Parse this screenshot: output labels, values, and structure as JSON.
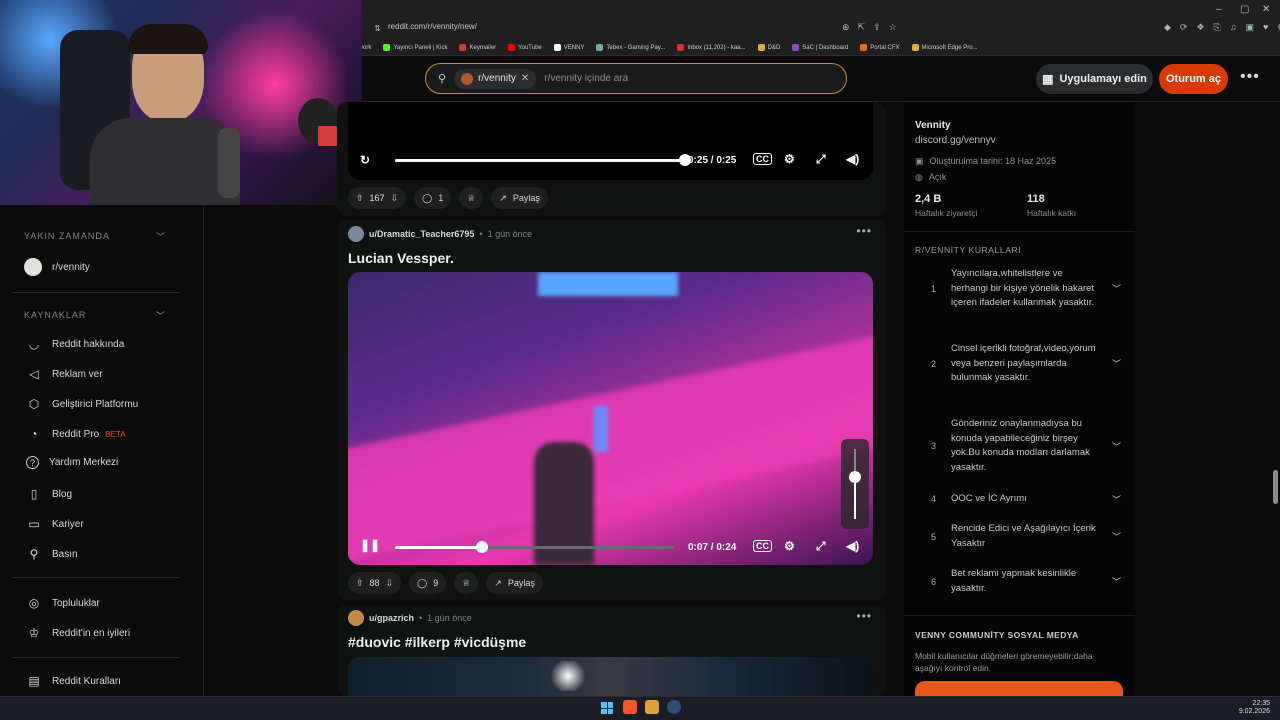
{
  "browser": {
    "url": "reddit.com/r/vennity/new/",
    "bookmarks": [
      "twork",
      "Yayıncı Paneli | Kick",
      "Keymailer",
      "YouTube",
      "VENNY",
      "Tebex - Gaming Pay...",
      "Inbox (11,202) - kaa...",
      "D&D",
      "SaC | Dashboard",
      "Portal CFX",
      "Microsoft Edge Pro..."
    ],
    "window_controls": [
      "–",
      "▢",
      "✕"
    ]
  },
  "header": {
    "community_chip": "r/vennity",
    "search_placeholder": "r/vennity içinde ara",
    "app_button": "Uygulamayı edin",
    "login_button": "Oturum aç",
    "more": "•••"
  },
  "sidebar": {
    "recent_title": "YAKIN ZAMANDA",
    "recent_item": "r/vennity",
    "resources_title": "KAYNAKLAR",
    "resources": [
      {
        "label": "Reddit hakkında",
        "icon": "alien-icon",
        "glyph": "◡"
      },
      {
        "label": "Reklam ver",
        "icon": "megaphone-icon",
        "glyph": "◁"
      },
      {
        "label": "Geliştirici Platformu",
        "icon": "hexagon-icon",
        "glyph": "⬡"
      },
      {
        "label": "Reddit Pro",
        "icon": "pro-icon",
        "glyph": "◔",
        "badge": "BETA"
      },
      {
        "label": "Yardım Merkezi",
        "icon": "help-icon",
        "glyph": "?"
      },
      {
        "label": "Blog",
        "icon": "book-icon",
        "glyph": "▯"
      },
      {
        "label": "Kariyer",
        "icon": "briefcase-icon",
        "glyph": "▭"
      },
      {
        "label": "Basın",
        "icon": "mic-icon",
        "glyph": "⚲"
      }
    ],
    "communities": [
      {
        "label": "Topluluklar",
        "icon": "communities-icon",
        "glyph": "◎"
      },
      {
        "label": "Reddit'in en iyileri",
        "icon": "best-of-icon",
        "glyph": "♔"
      }
    ],
    "rules_link": {
      "label": "Reddit Kuralları",
      "icon": "rules-icon",
      "glyph": "▤"
    }
  },
  "posts": [
    {
      "time_display": "0:25 / 0:25",
      "progress": 1.0,
      "upvotes": "167",
      "comments": "1",
      "share": "Paylaş"
    },
    {
      "user": "u/Dramatic_Teacher6795",
      "time": "1 gün önce",
      "title": "Lucian Vessper.",
      "time_display": "0:07 / 0:24",
      "progress": 0.31,
      "volume": 0.6,
      "upvotes": "88",
      "comments": "9",
      "share": "Paylaş"
    },
    {
      "user": "u/gpazrich",
      "time": "1 gün önce",
      "title": "#duovic #ilkerp #vicdüşme"
    }
  ],
  "community": {
    "name": "Vennity",
    "link": "discord.gg/vennyv",
    "created": "Oluşturulma tarihi: 18 Haz 2025",
    "visibility": "Açık",
    "weekly_visitors": "2,4 B",
    "weekly_visitors_label": "Haftalık ziyaretçi",
    "weekly_contrib": "118",
    "weekly_contrib_label": "Haftalık katkı",
    "rules_title": "R/VENNİTY KURALLARI",
    "rules": [
      {
        "num": "1",
        "text": "Yayıncılara,whitelistlere ve herhangi bir kişiye yönelik hakaret içeren ifadeler kullanmak yasaktır."
      },
      {
        "num": "2",
        "text": "Cinsel içerikli fotoğraf,video,yorum veya benzeri paylaşımlarda bulunmak yasaktır."
      },
      {
        "num": "3",
        "text": "Gönderiniz onaylanmadıysa bu konuda yapabileceğiniz birşey yok.Bu konuda modları darlamak yasaktır."
      },
      {
        "num": "4",
        "text": "OOC ve İC Ayrımı"
      },
      {
        "num": "5",
        "text": "Rencide Edici ve Aşağılayıcı İçerik Yasaktır"
      },
      {
        "num": "6",
        "text": "Bet reklamı yapmak kesinlikle yasaktır."
      }
    ],
    "social_title": "VENNY COMMUNİTY SOSYAL MEDYA",
    "social_text": "Mobil kullanıcılar düğmeleri göremeyebilir;daha aşağıyı kontrol edin."
  },
  "taskbar": {
    "time": "22:35",
    "date": "9.02.2026"
  },
  "colors": {
    "accent": "#d93a00",
    "search_border": "#c09022",
    "beta": "#ff4500"
  }
}
